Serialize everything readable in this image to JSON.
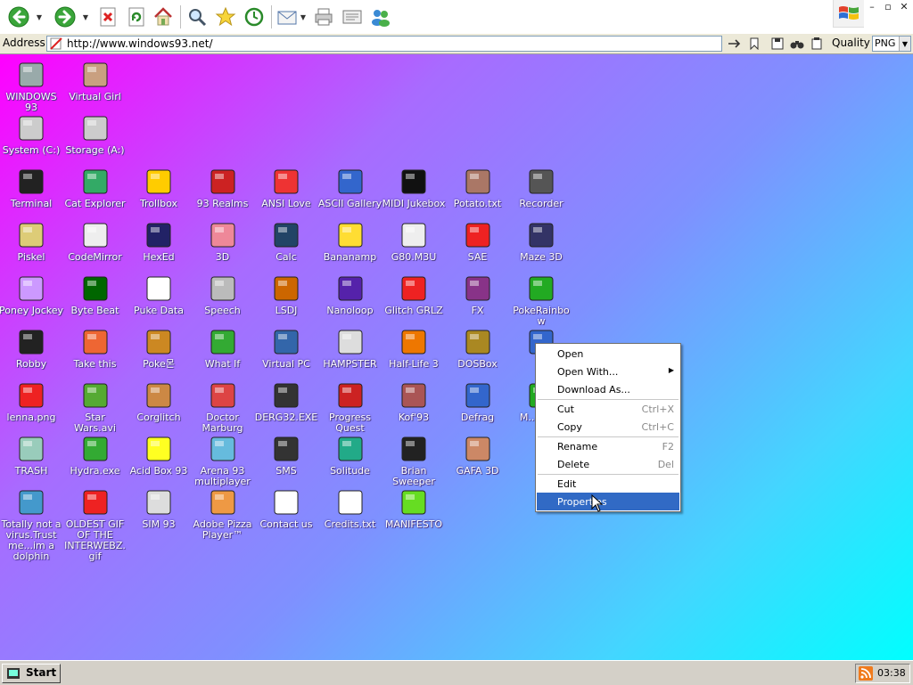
{
  "toolbar": {
    "buttons": [
      {
        "name": "back-button",
        "icon": "back-arrow-icon"
      },
      {
        "name": "forward-button",
        "icon": "forward-arrow-icon"
      },
      {
        "name": "stop-button",
        "icon": "stop-icon"
      },
      {
        "name": "refresh-button",
        "icon": "refresh-icon"
      },
      {
        "name": "home-button",
        "icon": "home-icon"
      },
      {
        "name": "search-button",
        "icon": "search-icon"
      },
      {
        "name": "favorites-button",
        "icon": "star-icon"
      },
      {
        "name": "history-button",
        "icon": "history-icon"
      },
      {
        "name": "mail-button",
        "icon": "mail-icon"
      },
      {
        "name": "print-button",
        "icon": "print-icon"
      },
      {
        "name": "edit-button",
        "icon": "edit-icon"
      },
      {
        "name": "messenger-button",
        "icon": "messenger-icon"
      }
    ],
    "window_controls": [
      "–",
      "▫",
      "✕"
    ]
  },
  "address": {
    "label": "Address",
    "url": "http://www.windows93.net/",
    "quality_label": "Quality",
    "quality_value": "PNG"
  },
  "desktop": {
    "icons": [
      {
        "id": "windows93",
        "label": "WINDOWS 93",
        "icon": "computer-icon",
        "color": "#9aa"
      },
      {
        "id": "virtual-girl",
        "label": "Virtual Girl",
        "icon": "girl-photo-icon",
        "color": "#c9a080"
      },
      {
        "id": "system-c",
        "label": "System (C:)",
        "icon": "hard-drive-icon",
        "color": "#ccc"
      },
      {
        "id": "storage-a",
        "label": "Storage (A:)",
        "icon": "floppy-drive-icon",
        "color": "#ccc"
      },
      {
        "id": "terminal",
        "label": "Terminal",
        "icon": "terminal-icon",
        "color": "#222"
      },
      {
        "id": "cat-explorer",
        "label": "Cat Explorer",
        "icon": "globe-cat-icon",
        "color": "#3a6"
      },
      {
        "id": "trollbox",
        "label": "Trollbox",
        "icon": "troll-chat-icon",
        "color": "#fc0"
      },
      {
        "id": "93-realms",
        "label": "93 Realms",
        "icon": "realm-knight-icon",
        "color": "#c22"
      },
      {
        "id": "ansi-love",
        "label": "ANSI Love",
        "icon": "ansi-letter-icon",
        "color": "#e33"
      },
      {
        "id": "ascii-gallery",
        "label": "ASCII Gallery",
        "icon": "ascii-123-icon",
        "color": "#36c"
      },
      {
        "id": "midi-jukebox",
        "label": "MIDI Jukebox",
        "icon": "piano-keys-icon",
        "color": "#111"
      },
      {
        "id": "potato",
        "label": "Potato.txt",
        "icon": "potato-icon",
        "color": "#a76"
      },
      {
        "id": "recorder",
        "label": "Recorder",
        "icon": "microphone-icon",
        "color": "#555"
      },
      {
        "id": "piskel",
        "label": "Piskel",
        "icon": "palette-icon",
        "color": "#dc7"
      },
      {
        "id": "codemirror",
        "label": "CodeMirror",
        "icon": "codemirror-icon",
        "color": "#eee"
      },
      {
        "id": "hexed",
        "label": "HexEd",
        "icon": "cube-icon",
        "color": "#226"
      },
      {
        "id": "3d",
        "label": "3D",
        "icon": "teapot-icon",
        "color": "#e89"
      },
      {
        "id": "calc",
        "label": "Calc",
        "icon": "calculator-icon",
        "color": "#246"
      },
      {
        "id": "bananamp",
        "label": "Bananamp",
        "icon": "banana-icon",
        "color": "#fd3"
      },
      {
        "id": "g80m3u",
        "label": "G80.M3U",
        "icon": "music-doc-icon",
        "color": "#eee"
      },
      {
        "id": "sae",
        "label": "SAE",
        "icon": "amiga-ball-icon",
        "color": "#e22"
      },
      {
        "id": "maze3d",
        "label": "Maze 3D",
        "icon": "maze-icon",
        "color": "#336"
      },
      {
        "id": "poney-jockey",
        "label": "Poney Jockey",
        "icon": "pony-icon",
        "color": "#c9f"
      },
      {
        "id": "byte-beat",
        "label": "Byte Beat",
        "icon": "byte-beat-icon",
        "color": "#060"
      },
      {
        "id": "puke-data",
        "label": "Puke Data",
        "icon": "pd-icon",
        "color": "#fff"
      },
      {
        "id": "speech",
        "label": "Speech",
        "icon": "face-icon",
        "color": "#bbb"
      },
      {
        "id": "lsdj",
        "label": "LSDJ",
        "icon": "gameboy-icon",
        "color": "#c60"
      },
      {
        "id": "nanoloop",
        "label": "Nanoloop",
        "icon": "nanoloop-icon",
        "color": "#52a"
      },
      {
        "id": "glitch-grlz",
        "label": "Glitch GRLZ",
        "icon": "lips-icon",
        "color": "#e22"
      },
      {
        "id": "fx",
        "label": "FX",
        "icon": "atom-icon",
        "color": "#838"
      },
      {
        "id": "pokerainbow",
        "label": "PokeRainbow",
        "icon": "pokerainbow-icon",
        "color": "#2a2"
      },
      {
        "id": "robby",
        "label": "Robby",
        "icon": "stick-figure-icon",
        "color": "#222"
      },
      {
        "id": "take-this",
        "label": "Take this",
        "icon": "old-man-icon",
        "color": "#e63"
      },
      {
        "id": "pokemon",
        "label": "Poke몬",
        "icon": "poke-icon",
        "color": "#c82"
      },
      {
        "id": "what-if",
        "label": "What If",
        "icon": "what-if-icon",
        "color": "#3a3"
      },
      {
        "id": "virtual-pc",
        "label": "Virtual PC",
        "icon": "virtual-pc-icon",
        "color": "#36a"
      },
      {
        "id": "hampster",
        "label": "HAMPSTER",
        "icon": "hamster-icon",
        "color": "#ddd"
      },
      {
        "id": "half-life-3",
        "label": "Half-Life 3",
        "icon": "lambda-icon",
        "color": "#e70"
      },
      {
        "id": "dosbox",
        "label": "DOSBox",
        "icon": "dosbox-icon",
        "color": "#a82"
      },
      {
        "id": "properties-target",
        "label": "",
        "icon": "blank-window-icon",
        "color": "#36c"
      },
      {
        "id": "lenna",
        "label": "lenna.png",
        "icon": "image-doc-icon",
        "color": "#e22"
      },
      {
        "id": "star-wars",
        "label": "Star Wars.avi",
        "icon": "yoda-icon",
        "color": "#5a3"
      },
      {
        "id": "corglitch",
        "label": "Corglitch",
        "icon": "corgi-icon",
        "color": "#c84"
      },
      {
        "id": "doctor-marburg",
        "label": "Doctor Marburg",
        "icon": "doctor-icon",
        "color": "#d44"
      },
      {
        "id": "derc32",
        "label": "DERG32.EXE",
        "icon": "derg-monitor-icon",
        "color": "#333"
      },
      {
        "id": "progress-quest",
        "label": "Progress Quest",
        "icon": "swords-icon",
        "color": "#c22"
      },
      {
        "id": "kof93",
        "label": "Kof'93",
        "icon": "fighter-icon",
        "color": "#a55"
      },
      {
        "id": "defrag",
        "label": "Defrag",
        "icon": "defrag-icon",
        "color": "#36c"
      },
      {
        "id": "ms-be",
        "label": "M... Be...",
        "icon": "globe-green-icon",
        "color": "#2a2"
      },
      {
        "id": "trash",
        "label": "TRASH",
        "icon": "recycle-bin-icon",
        "color": "#9cb"
      },
      {
        "id": "hydra",
        "label": "Hydra.exe",
        "icon": "hydra-icon",
        "color": "#3a3"
      },
      {
        "id": "acid-box",
        "label": "Acid Box 93",
        "icon": "smiley-icon",
        "color": "#ff2"
      },
      {
        "id": "arena93",
        "label": "Arena 93 multiplayer",
        "icon": "cube-color-icon",
        "color": "#6bd"
      },
      {
        "id": "sms",
        "label": "SMS",
        "icon": "console-icon",
        "color": "#333"
      },
      {
        "id": "solitude",
        "label": "Solitude",
        "icon": "solitude-icon",
        "color": "#2a8"
      },
      {
        "id": "brian-sweeper",
        "label": "Brian Sweeper",
        "icon": "mine-icon",
        "color": "#222"
      },
      {
        "id": "gafa3d",
        "label": "GAFA 3D",
        "icon": "gafa-face-icon",
        "color": "#c86"
      },
      {
        "id": "dolphin",
        "label": "Totally not a virus.Trust me...im a dolphin",
        "icon": "dolphin-icon",
        "color": "#49c"
      },
      {
        "id": "oldest-gif",
        "label": "OLDEST GIF OF THE INTERWEBZ.gif",
        "icon": "gif-doc-icon",
        "color": "#e22"
      },
      {
        "id": "sim93",
        "label": "SIM 93",
        "icon": "sim-book-icon",
        "color": "#ddd"
      },
      {
        "id": "adobe-pizza",
        "label": "Adobe Pizza Player™",
        "icon": "pizza-icon",
        "color": "#e94"
      },
      {
        "id": "contact-us",
        "label": "Contact us",
        "icon": "contact-pen-icon",
        "color": "#fff"
      },
      {
        "id": "credits",
        "label": "Credits.txt",
        "icon": "text-doc-icon",
        "color": "#fff"
      },
      {
        "id": "manifesto",
        "label": "MANIFESTO",
        "icon": "question-mark-icon",
        "color": "#6d2"
      }
    ]
  },
  "context_menu": {
    "groups": [
      [
        {
          "label": "Open",
          "shortcut": "",
          "submenu": false
        },
        {
          "label": "Open With...",
          "shortcut": "",
          "submenu": true
        },
        {
          "label": "Download As...",
          "shortcut": "",
          "submenu": false
        }
      ],
      [
        {
          "label": "Cut",
          "shortcut": "Ctrl+X",
          "submenu": false
        },
        {
          "label": "Copy",
          "shortcut": "Ctrl+C",
          "submenu": false
        }
      ],
      [
        {
          "label": "Rename",
          "shortcut": "F2",
          "submenu": false
        },
        {
          "label": "Delete",
          "shortcut": "Del",
          "submenu": false
        }
      ],
      [
        {
          "label": "Edit",
          "shortcut": "",
          "submenu": false
        },
        {
          "label": "Properties",
          "shortcut": "",
          "submenu": false,
          "highlighted": true
        }
      ]
    ]
  },
  "taskbar": {
    "start_label": "Start",
    "clock": "03:38"
  }
}
